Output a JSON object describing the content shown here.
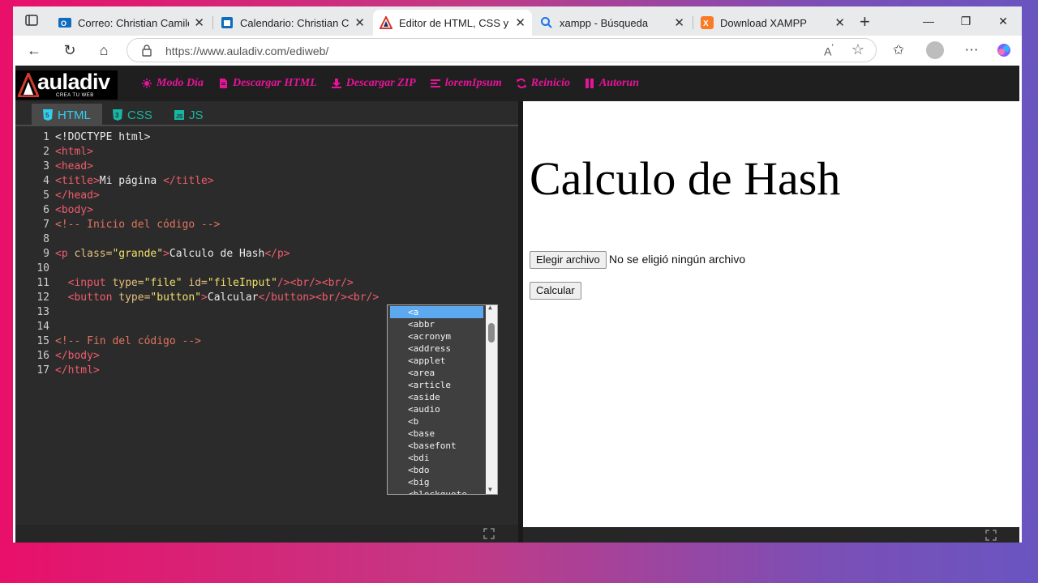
{
  "browser": {
    "tabs": [
      {
        "title": "Correo: Christian Camilo Se",
        "active": false
      },
      {
        "title": "Calendario: Christian Camil",
        "active": false
      },
      {
        "title": "Editor de HTML, CSS y Java",
        "active": true
      },
      {
        "title": "xampp - Búsqueda",
        "active": false
      },
      {
        "title": "Download XAMPP",
        "active": false
      }
    ],
    "url": "https://www.auladiv.com/ediweb/"
  },
  "site": {
    "logo_text": "auladiv",
    "logo_sub": "CREA TU WEB",
    "menu": [
      "Modo Día",
      "Descargar HTML",
      "Descargar ZIP",
      "loremIpsum",
      "Reinicio",
      "Autorun"
    ]
  },
  "editor": {
    "tabs": [
      "HTML",
      "CSS",
      "JS"
    ],
    "lines": [
      {
        "n": "1",
        "segs": [
          [
            "txt",
            "<!DOCTYPE html>"
          ]
        ]
      },
      {
        "n": "2",
        "segs": [
          [
            "tag",
            "<html>"
          ]
        ]
      },
      {
        "n": "3",
        "segs": [
          [
            "tag",
            "<head>"
          ]
        ]
      },
      {
        "n": "4",
        "segs": [
          [
            "tag",
            "<title>"
          ],
          [
            "txt",
            "Mi página "
          ],
          [
            "tag",
            "</title>"
          ]
        ]
      },
      {
        "n": "5",
        "segs": [
          [
            "tag",
            "</head>"
          ]
        ]
      },
      {
        "n": "6",
        "segs": [
          [
            "tag",
            "<body>"
          ]
        ]
      },
      {
        "n": "7",
        "segs": [
          [
            "cmt",
            "<!-- Inicio del código -->"
          ]
        ]
      },
      {
        "n": "8",
        "segs": []
      },
      {
        "n": "9",
        "segs": [
          [
            "tag",
            "<p "
          ],
          [
            "attr",
            "class="
          ],
          [
            "str",
            "\"grande\""
          ],
          [
            "tag",
            ">"
          ],
          [
            "txt",
            "Calculo de Hash"
          ],
          [
            "tag",
            "</p>"
          ]
        ]
      },
      {
        "n": "10",
        "segs": []
      },
      {
        "n": "11",
        "segs": [
          [
            "txt",
            "  "
          ],
          [
            "tag",
            "<input "
          ],
          [
            "attr",
            "type="
          ],
          [
            "str",
            "\"file\""
          ],
          [
            "attr",
            " id="
          ],
          [
            "str",
            "\"fileInput\""
          ],
          [
            "tag",
            "/><br/><br/>"
          ]
        ]
      },
      {
        "n": "12",
        "segs": [
          [
            "txt",
            "  "
          ],
          [
            "tag",
            "<button "
          ],
          [
            "attr",
            "type="
          ],
          [
            "str",
            "\"button\""
          ],
          [
            "tag",
            ">"
          ],
          [
            "txt",
            "Calcular"
          ],
          [
            "tag",
            "</button><br/><br/>"
          ]
        ]
      },
      {
        "n": "13",
        "segs": []
      },
      {
        "n": "14",
        "segs": []
      },
      {
        "n": "15",
        "segs": [
          [
            "cmt",
            "<!-- Fin del código -->"
          ]
        ]
      },
      {
        "n": "16",
        "segs": [
          [
            "tag",
            "</body>"
          ]
        ]
      },
      {
        "n": "17",
        "segs": [
          [
            "tag",
            "</html>"
          ]
        ]
      }
    ],
    "autocomplete": [
      "<a",
      "<abbr",
      "<acronym",
      "<address",
      "<applet",
      "<area",
      "<article",
      "<aside",
      "<audio",
      "<b",
      "<base",
      "<basefont",
      "<bdi",
      "<bdo",
      "<big",
      "<blockquote"
    ]
  },
  "preview": {
    "heading": "Calculo de Hash",
    "file_button": "Elegir archivo",
    "no_file": "No se eligió ningún archivo",
    "calc_button": "Calcular"
  },
  "colors": {
    "menu_accent": "#e8139a",
    "tab_accent": "#16b8a5",
    "selection": "#5da9f0"
  }
}
